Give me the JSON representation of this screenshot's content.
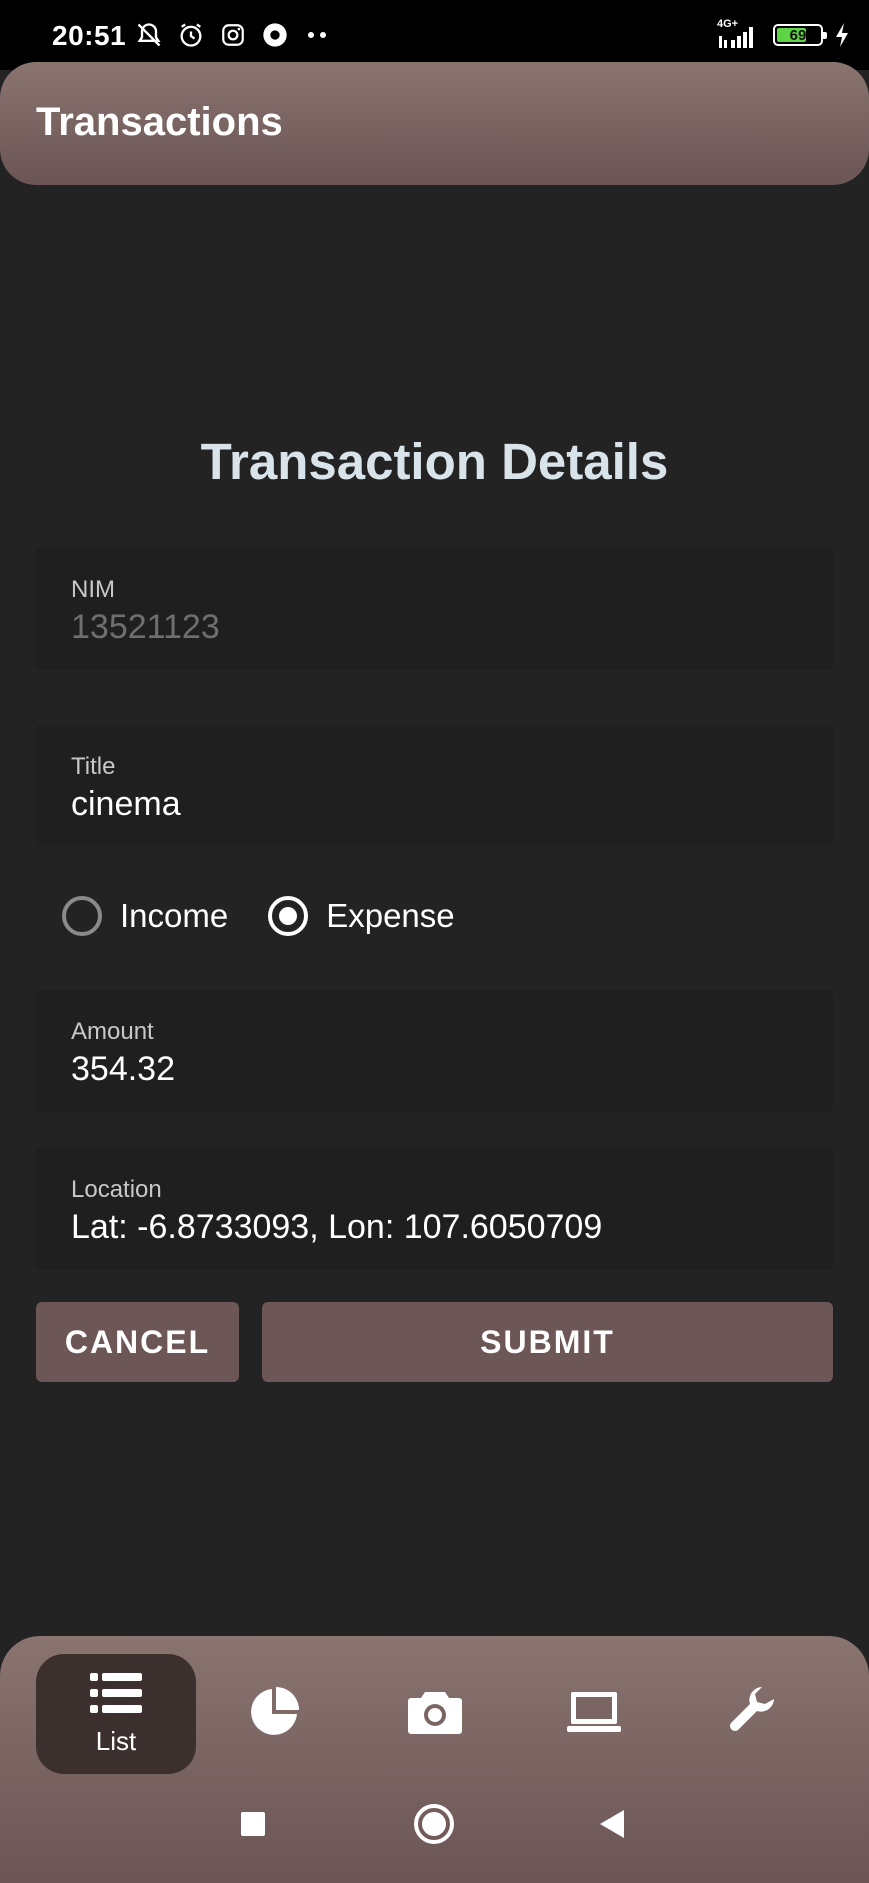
{
  "status_bar": {
    "time": "20:51",
    "network": "4G+",
    "battery": "69",
    "battery_level": 0.69,
    "left_icons": [
      "mute-bell-icon",
      "alarm-icon",
      "instagram-icon",
      "location-app-icon",
      "more-dots-icon"
    ],
    "right_icons": [
      "signal-icon",
      "battery-icon",
      "charging-icon"
    ]
  },
  "app_bar": {
    "title": "Transactions"
  },
  "form": {
    "heading": "Transaction Details",
    "nim": {
      "label": "NIM",
      "value": "13521123"
    },
    "title": {
      "label": "Title",
      "value": "cinema"
    },
    "type": {
      "options": [
        {
          "label": "Income",
          "checked": false
        },
        {
          "label": "Expense",
          "checked": true
        }
      ]
    },
    "amount": {
      "label": "Amount",
      "value": "354.32"
    },
    "location": {
      "label": "Location",
      "value": "Lat: -6.8733093, Lon: 107.6050709"
    },
    "cancel_label": "CANCEL",
    "submit_label": "SUBMIT"
  },
  "bottom_nav": {
    "items": [
      {
        "icon": "list-icon",
        "label": "List",
        "active": true
      },
      {
        "icon": "pie-chart-icon",
        "label": "",
        "active": false
      },
      {
        "icon": "camera-icon",
        "label": "",
        "active": false
      },
      {
        "icon": "laptop-icon",
        "label": "",
        "active": false
      },
      {
        "icon": "wrench-icon",
        "label": "",
        "active": false
      }
    ]
  },
  "colors": {
    "background": "#232323",
    "accent": "#6d5656",
    "bar_gradient_top": "#8a7470",
    "heading": "#d9e4ea"
  }
}
